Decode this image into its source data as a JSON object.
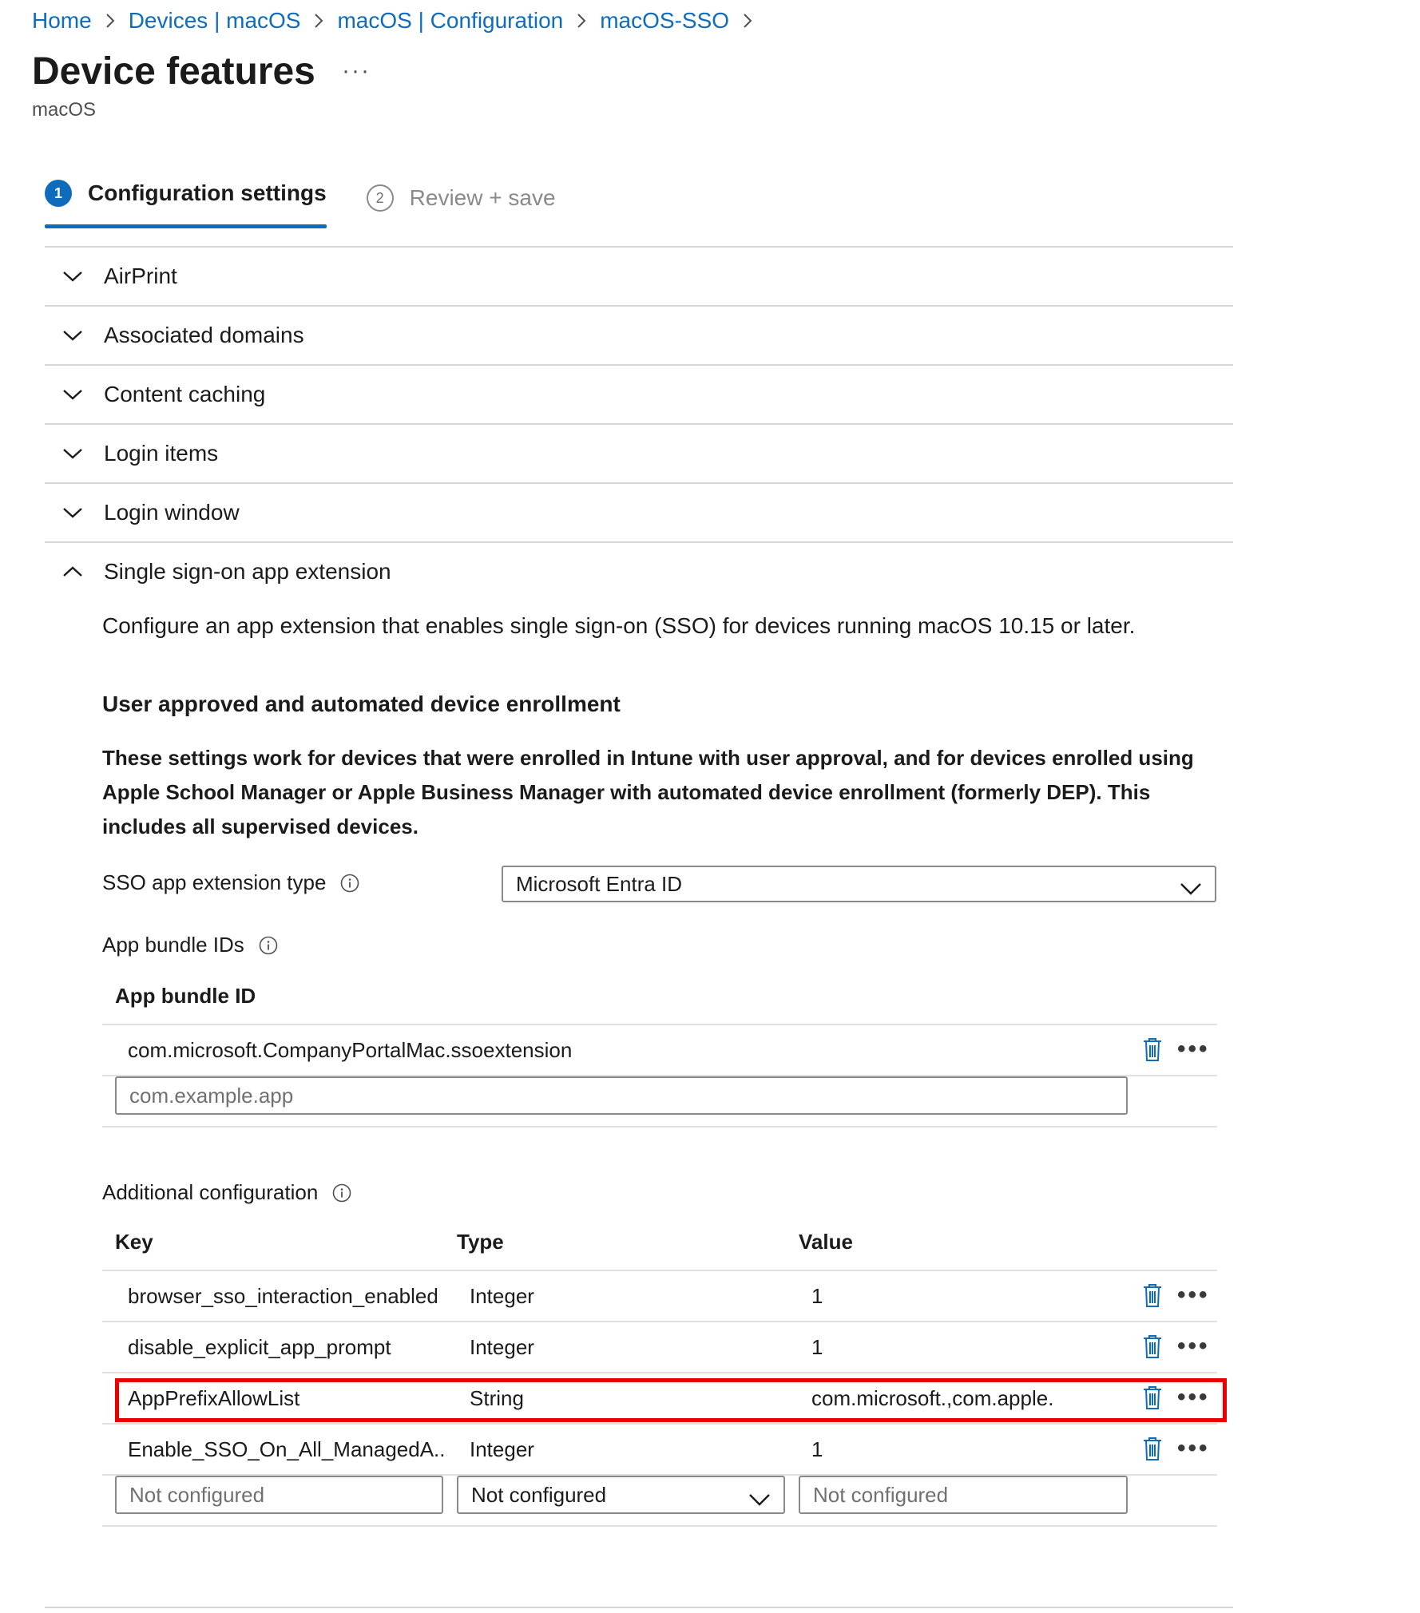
{
  "breadcrumb": [
    "Home",
    "Devices | macOS",
    "macOS | Configuration",
    "macOS-SSO"
  ],
  "header": {
    "title": "Device features",
    "more": "···",
    "subtitle": "macOS"
  },
  "steps": [
    {
      "number": "1",
      "label": "Configuration settings"
    },
    {
      "number": "2",
      "label": "Review + save"
    }
  ],
  "sections": [
    "AirPrint",
    "Associated domains",
    "Content caching",
    "Login items",
    "Login window",
    "Single sign-on app extension"
  ],
  "sso": {
    "description": "Configure an app extension that enables single sign-on (SSO) for devices running macOS 10.15 or later.",
    "heading": "User approved and automated device enrollment",
    "note": "These settings work for devices that were enrolled in Intune with user approval, and for devices enrolled using Apple School Manager or Apple Business Manager with automated device enrollment (formerly DEP). This includes all supervised devices.",
    "type_label": "SSO app extension type",
    "type_value": "Microsoft Entra ID",
    "bundle_label": "App bundle IDs",
    "bundle_header": "App bundle ID",
    "bundle_rows": [
      "com.microsoft.CompanyPortalMac.ssoextension"
    ],
    "bundle_placeholder": "com.example.app",
    "additional_label": "Additional configuration",
    "columns": {
      "key": "Key",
      "type": "Type",
      "value": "Value"
    },
    "rows": [
      {
        "key": "browser_sso_interaction_enabled",
        "type": "Integer",
        "value": "1"
      },
      {
        "key": "disable_explicit_app_prompt",
        "type": "Integer",
        "value": "1"
      },
      {
        "key": "AppPrefixAllowList",
        "type": "String",
        "value": "com.microsoft.,com.apple."
      },
      {
        "key": "Enable_SSO_On_All_ManagedA...",
        "type": "Integer",
        "value": "1"
      }
    ],
    "new_row": {
      "key_placeholder": "Not configured",
      "type_value": "Not configured",
      "value_placeholder": "Not configured"
    },
    "more": "•••"
  },
  "colors": {
    "accent": "#0f6cbd",
    "highlight": "#ea0000"
  }
}
